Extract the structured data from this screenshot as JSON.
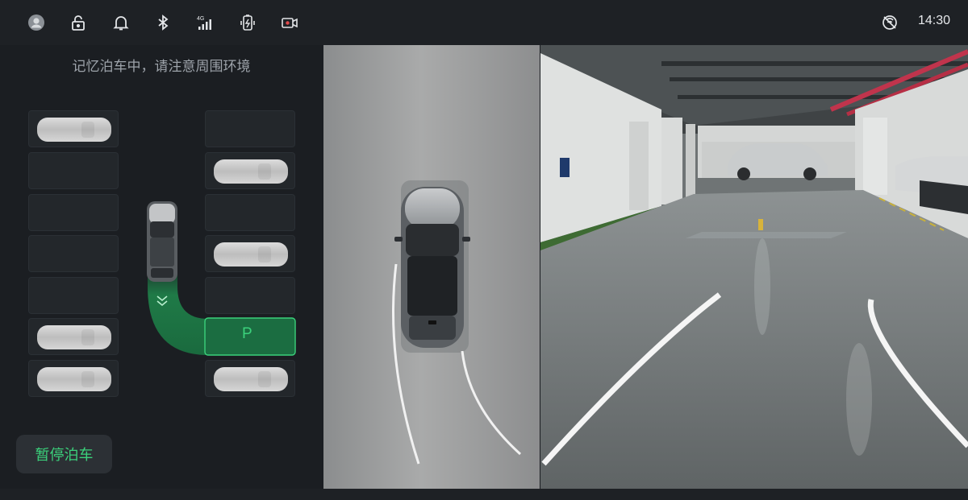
{
  "status_bar": {
    "icons": [
      "avatar-icon",
      "lock-icon",
      "bell-icon",
      "bluetooth-icon",
      "signal-4g-icon",
      "battery-icon",
      "dashcam-icon",
      "no-signal-icon"
    ],
    "network_label": "4G",
    "time": "14:30"
  },
  "parking": {
    "hint": "记忆泊车中，请注意周围环境",
    "target_label": "P",
    "pause_button": "暂停泊车",
    "slots_left_occupied": [
      true,
      false,
      false,
      false,
      false,
      true,
      true
    ],
    "slots_right_occupied": [
      false,
      true,
      false,
      true,
      false,
      false,
      true
    ],
    "accent_color": "#3bd17b"
  }
}
